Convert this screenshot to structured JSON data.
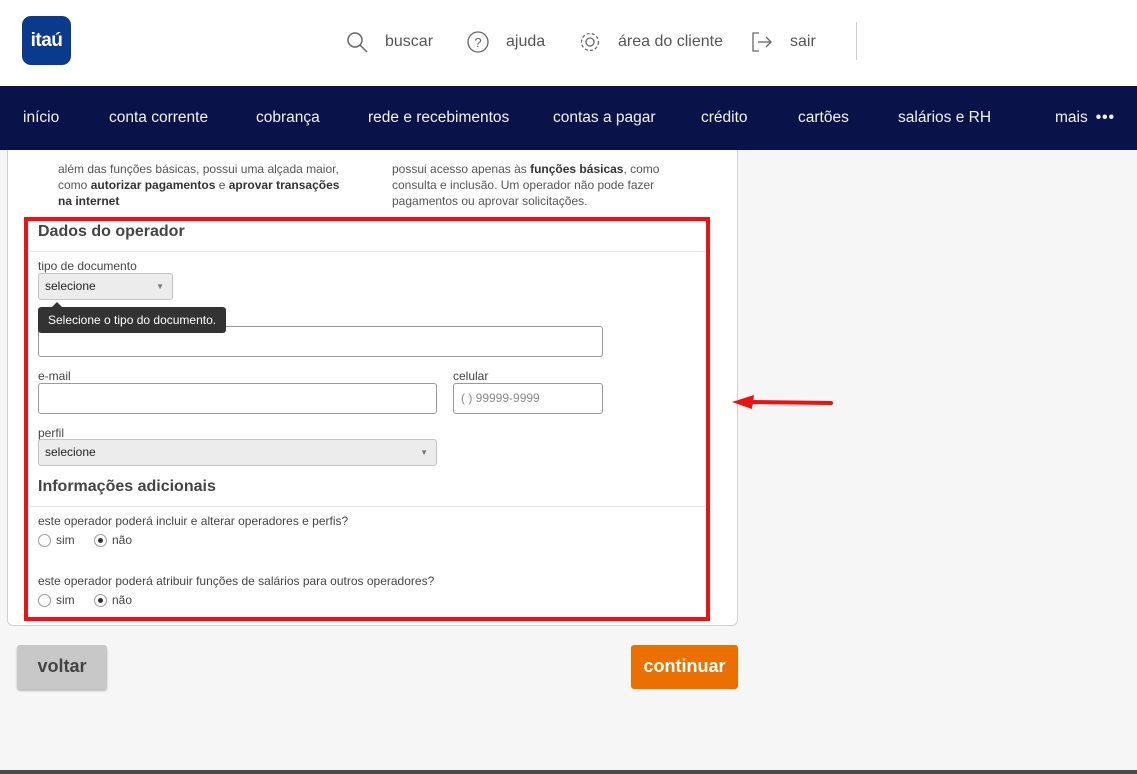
{
  "brand": {
    "logo_text": "itaú",
    "logo_color": "#0a3a8c"
  },
  "topnav": {
    "buscar": "buscar",
    "ajuda": "ajuda",
    "area_cliente": "área do cliente",
    "sair": "sair",
    "icons": [
      "search-icon",
      "help-icon",
      "gear-icon",
      "logout-icon"
    ]
  },
  "mainnav": {
    "items": [
      "início",
      "conta corrente",
      "cobrança",
      "rede e recebimentos",
      "contas a pagar",
      "crédito",
      "cartões",
      "salários e RH",
      "mais"
    ],
    "more_icon": "ellipsis-icon",
    "background": "#09134a"
  },
  "profiles": {
    "master_desc": [
      "além das funções básicas, possui uma alçada maior,",
      "como ",
      "autorizar pagamentos",
      " e ",
      "aprovar transações",
      "na internet",
      "."
    ],
    "operator_desc": [
      "possui acesso apenas às ",
      "funções básicas",
      ", como",
      "consulta e inclusão. Um operador não pode fazer",
      "pagamentos ou aprovar solicitações."
    ]
  },
  "form": {
    "title": "Dados do operador",
    "doc_type_label": "tipo de documento",
    "doc_type_value": "selecione",
    "tooltip": "Selecione o tipo do documento.",
    "email_label": "e-mail",
    "phone_label": "celular",
    "phone_placeholder": "(  ) 99999-9999",
    "profile_label": "perfil",
    "profile_value": "selecione"
  },
  "additional": {
    "title": "Informações adicionais",
    "q1": "este operador poderá incluir e alterar operadores e perfis?",
    "q2": "este operador poderá atribuir funções de salários para outros operadores?",
    "yes": "sim",
    "no": "não",
    "q1_selected": "não",
    "q2_selected": "não"
  },
  "buttons": {
    "back": "voltar",
    "continue": "continuar"
  },
  "colors": {
    "highlight": "#ee1111",
    "accent": "#ec7000",
    "arrow": "#ee1111"
  }
}
